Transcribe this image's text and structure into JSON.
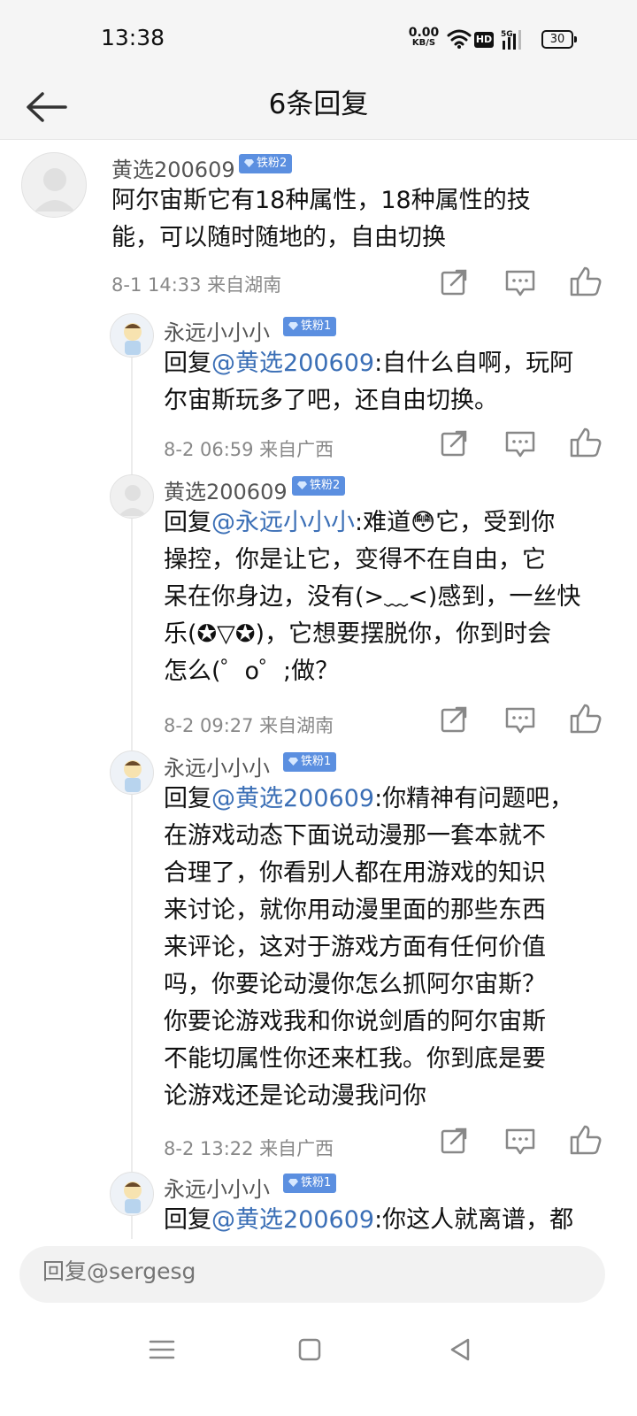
{
  "status_bar": {
    "time": "13:38",
    "net_speed": "0.00",
    "net_unit": "KB/S",
    "hd": "HD",
    "signal_label": "5G",
    "battery": "30"
  },
  "header": {
    "title": "6条回复"
  },
  "main_comment": {
    "username": "黄选200609",
    "badge": "铁粉2",
    "text_lines": [
      "阿尔宙斯它有18种属性，18种属性的技",
      "能，可以随时随地的，自由切换"
    ],
    "meta": "8-1 14:33  来自湖南"
  },
  "replies": [
    {
      "username": "永远小小小",
      "badge": "铁粉1",
      "reply_prefix": "回复",
      "mention": "@黄选200609",
      "text_first": ":自什么自啊，玩阿",
      "text_lines": [
        "尔宙斯玩多了吧，还自由切换。"
      ],
      "meta": "8-2 06:59  来自广西"
    },
    {
      "username": "黄选200609",
      "badge": "铁粉2",
      "reply_prefix": "回复",
      "mention": "@永远小小小",
      "text_first": ":难道😳它，受到你",
      "text_lines": [
        "操控，你是让它，变得不在自由，它",
        "呆在你身边，没有(>﹏<)感到，一丝快",
        "乐(✪▽✪)，它想要摆脱你，你到时会",
        "怎么(゜o゜;做？"
      ],
      "meta": "8-2 09:27  来自湖南"
    },
    {
      "username": "永远小小小",
      "badge": "铁粉1",
      "reply_prefix": "回复",
      "mention": "@黄选200609",
      "text_first": ":你精神有问题吧，",
      "text_lines": [
        "在游戏动态下面说动漫那一套本就不",
        "合理了，你看别人都在用游戏的知识",
        "来讨论，就你用动漫里面的那些东西",
        "来评论，这对于游戏方面有任何价值",
        "吗，你要论动漫你怎么抓阿尔宙斯？",
        "你要论游戏我和你说剑盾的阿尔宙斯",
        "不能切属性你还来杠我。你到底是要",
        "论游戏还是论动漫我问你"
      ],
      "meta": "8-2 13:22  来自广西"
    },
    {
      "username": "永远小小小",
      "badge": "铁粉1",
      "reply_prefix": "回复",
      "mention": "@黄选200609",
      "text_first": ":你这人就离谱，都",
      "text_lines": []
    }
  ],
  "reply_bar": {
    "placeholder": "回复@sergesg"
  },
  "icons": {
    "share": "share-icon",
    "comment": "comment-icon",
    "like": "like-icon"
  },
  "colors": {
    "mention": "#3b6fb6",
    "badge": "#5b8fe0",
    "meta": "#888888"
  }
}
